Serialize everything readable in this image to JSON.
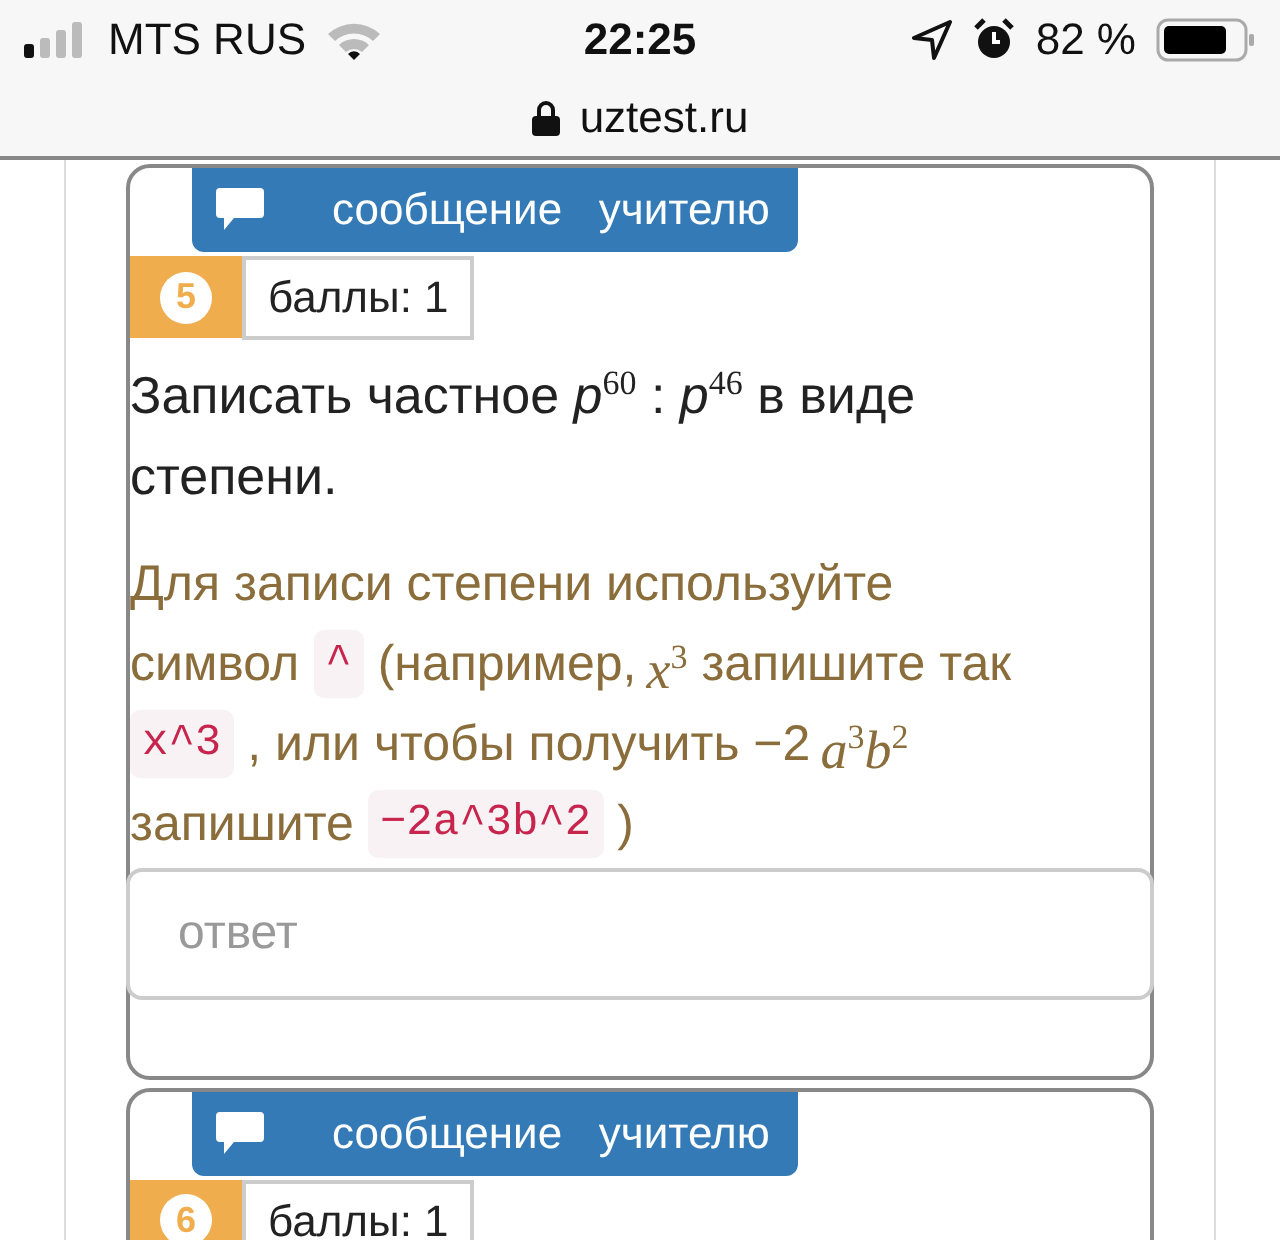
{
  "status_bar": {
    "carrier": "MTS RUS",
    "time": "22:25",
    "battery": "82 %"
  },
  "address_bar": {
    "url": "uztest.ru"
  },
  "questions": [
    {
      "number": "5",
      "message_button": "сообщение   учителю",
      "points": "баллы: 1",
      "question": "Записать частное *p*$^{60}$ : *p*$^{46}$ в виде степени.",
      "hint": [
        [
          {
            "kind": "text",
            "text": "Для записи степени используйте"
          }
        ],
        [
          {
            "kind": "text",
            "text": "символ"
          },
          {
            "kind": "code",
            "text": "^"
          },
          {
            "kind": "text",
            "text": "(например,"
          },
          {
            "kind": "math",
            "text": "x$^{3}$"
          },
          {
            "kind": "text",
            "text": "запишите так"
          }
        ],
        [
          {
            "kind": "code",
            "text": "x^3"
          },
          {
            "kind": "text",
            "text": ", или чтобы получить −2"
          },
          {
            "kind": "math",
            "text": "a$^{3}$b$^{2}$"
          }
        ],
        [
          {
            "kind": "text",
            "text": "запишите"
          },
          {
            "kind": "code",
            "text": "−2a^3b^2"
          },
          {
            "kind": "text",
            "text": ")"
          }
        ]
      ],
      "answer": {
        "placeholder": "ответ"
      }
    },
    {
      "number": "6",
      "message_button": "сообщение   учителю",
      "points": "баллы: 1"
    }
  ]
}
